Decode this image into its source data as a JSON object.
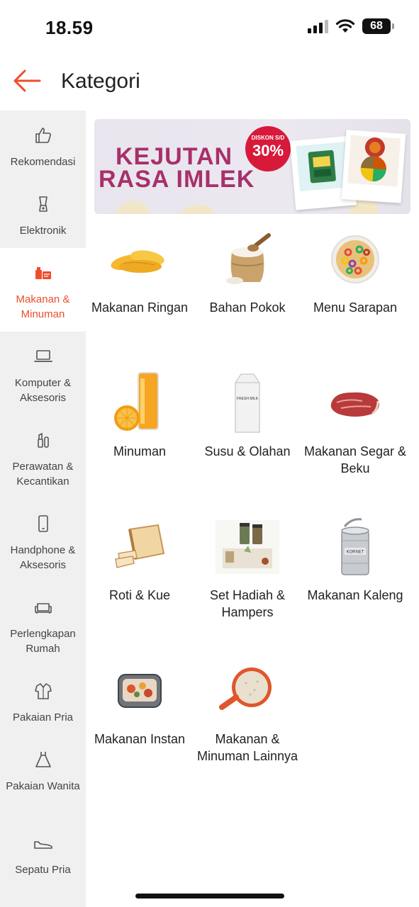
{
  "status": {
    "time": "18.59",
    "battery": "68"
  },
  "header": {
    "title": "Kategori"
  },
  "colors": {
    "accent": "#ee4d2d",
    "sidebar_bg": "#f0f0f0",
    "banner_text": "#a8306a",
    "badge": "#d71a3a"
  },
  "sidebar": {
    "items": [
      {
        "label": "Rekomendasi",
        "icon": "thumbs-up-icon"
      },
      {
        "label": "Elektronik",
        "icon": "blender-icon"
      },
      {
        "label": "Makanan & Minuman",
        "icon": "food-drink-icon",
        "active": true
      },
      {
        "label": "Komputer & Aksesoris",
        "icon": "laptop-icon"
      },
      {
        "label": "Perawatan & Kecantikan",
        "icon": "cosmetics-icon"
      },
      {
        "label": "Handphone & Aksesoris",
        "icon": "phone-icon"
      },
      {
        "label": "Perlengkapan Rumah",
        "icon": "sofa-icon"
      },
      {
        "label": "Pakaian Pria",
        "icon": "shirt-icon"
      },
      {
        "label": "Pakaian Wanita",
        "icon": "dress-icon"
      },
      {
        "label": "Sepatu Pria",
        "icon": "shoe-icon"
      }
    ]
  },
  "banner": {
    "line1": "KEJUTAN",
    "line2": "RASA IMLEK",
    "badge_small": "DISKON S/D",
    "badge_big": "30%"
  },
  "categories": [
    {
      "label": "Makanan Ringan",
      "image": "chips"
    },
    {
      "label": "Bahan Pokok",
      "image": "rice-sack"
    },
    {
      "label": "Menu Sarapan",
      "image": "cereal-bowl"
    },
    {
      "label": "Minuman",
      "image": "orange-juice"
    },
    {
      "label": "Susu & Olahan",
      "image": "milk-carton"
    },
    {
      "label": "Makanan Segar & Beku",
      "image": "raw-meat"
    },
    {
      "label": "Roti & Kue",
      "image": "bread-loaf"
    },
    {
      "label": "Set Hadiah & Hampers",
      "image": "gift-jars"
    },
    {
      "label": "Makanan Kaleng",
      "image": "corned-beef-can"
    },
    {
      "label": "Makanan Instan",
      "image": "instant-meal"
    },
    {
      "label": "Makanan & Minuman Lainnya",
      "image": "grain-pan"
    }
  ],
  "images": {
    "milk_label": "FRESH MILK",
    "can_label": "KORNET"
  }
}
